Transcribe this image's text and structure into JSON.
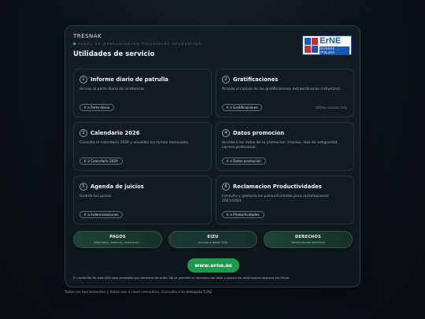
{
  "header": {
    "brand": "TRESNAK",
    "subtitle": "PANEL DE HERRAMIENTAS POLICIALES OPERATIVAS",
    "title": "Utilidades de servicio",
    "logo": {
      "big": "ErNE",
      "small": "EUSKAL POLIZIA"
    }
  },
  "cards": [
    {
      "num": "1",
      "title": "Informe diario de patrulla",
      "desc": "Acceso al parte diario de incidencias.",
      "button": "Ir a Parte diario",
      "meta": ""
    },
    {
      "num": "2",
      "title": "Gratificaciones",
      "desc": "Accede al calculo de las gratificaciones extraordinarias (refuerzos).",
      "button": "Ir a Gratificaciones",
      "meta": "Ultimo acceso: hoy"
    },
    {
      "num": "3",
      "title": "Calendario 2026",
      "desc": "Consulta el calendario 2026 y visualiza tus turnos mensuales.",
      "button": "Ir a Calendario 2026",
      "meta": ""
    },
    {
      "num": "4",
      "title": "Datos promocion",
      "desc": "Accede a los datos de tu promocion, trienios, dias de antiguedad, carrera profesional.",
      "button": "Ir a Datos promocion",
      "meta": ""
    },
    {
      "num": "5",
      "title": "Agenda de juicios",
      "desc": "Guarda tus juicios",
      "button": "Ir a Indemnizaciones",
      "meta": ""
    },
    {
      "num": "6",
      "title": "Reclamacion Productividades",
      "desc": "Consulta y gestiona las productividades para reclamaciones 2021/2024.",
      "button": "Ir a Productividades",
      "meta": ""
    }
  ],
  "pills": [
    {
      "title": "PAGOS",
      "sub": "Mercedes, restaurs, montures..."
    },
    {
      "title": "EIZU",
      "sub": "Acceso a panel Eizu"
    },
    {
      "title": "DERECHOS",
      "sub": "Derechos del detenido"
    }
  ],
  "web_button": "www.erne.es",
  "copyright": "El contenido de este sitio esta protegido por derechos de autor. No se permite su reproduccion total o parcial sin autorizacion expresa del titular.",
  "footnote": "Todas las herramientas y datos son a nivel consultivo. Consulta a tu delegado ErNE",
  "colors": {
    "accent": "#1f9a4c",
    "status_dot": "#2ed36a",
    "logo_blue": "#1a57b3",
    "logo_red": "#d22b2b"
  }
}
